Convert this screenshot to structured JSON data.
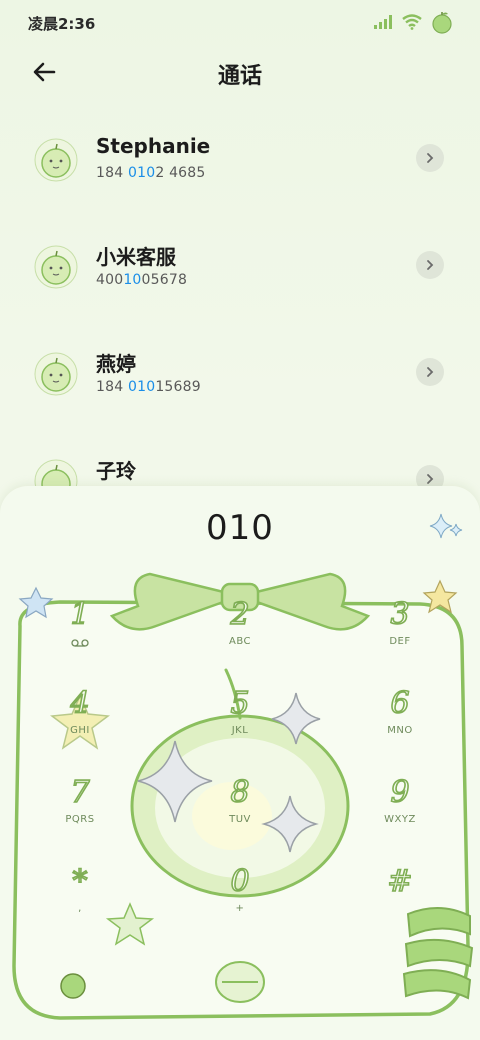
{
  "status": {
    "time": "凌晨2:36"
  },
  "header": {
    "title": "通话"
  },
  "contacts": [
    {
      "name": "Stephanie",
      "num_a": "184 ",
      "num_hl": "010",
      "num_b": "2 4685"
    },
    {
      "name": "小米客服",
      "num_a": "400",
      "num_hl": "10",
      "num_b": "05678"
    },
    {
      "name": "燕婷",
      "num_a": "184 ",
      "num_hl": "010",
      "num_b": "15689"
    },
    {
      "name": "子玲",
      "num_a": "",
      "num_hl": "",
      "num_b": ""
    }
  ],
  "dialer": {
    "input": "010",
    "keys": [
      {
        "digit": "1",
        "letters": ""
      },
      {
        "digit": "2",
        "letters": "ABC"
      },
      {
        "digit": "3",
        "letters": "DEF"
      },
      {
        "digit": "4",
        "letters": "GHI"
      },
      {
        "digit": "5",
        "letters": "JKL"
      },
      {
        "digit": "6",
        "letters": "MNO"
      },
      {
        "digit": "7",
        "letters": "PQRS"
      },
      {
        "digit": "8",
        "letters": "TUV"
      },
      {
        "digit": "9",
        "letters": "WXYZ"
      },
      {
        "digit": "*",
        "letters": ","
      },
      {
        "digit": "0",
        "letters": "+"
      },
      {
        "digit": "#",
        "letters": ""
      }
    ]
  },
  "colors": {
    "accent": "#1a8ee8",
    "theme_green": "#8bbf5e"
  }
}
